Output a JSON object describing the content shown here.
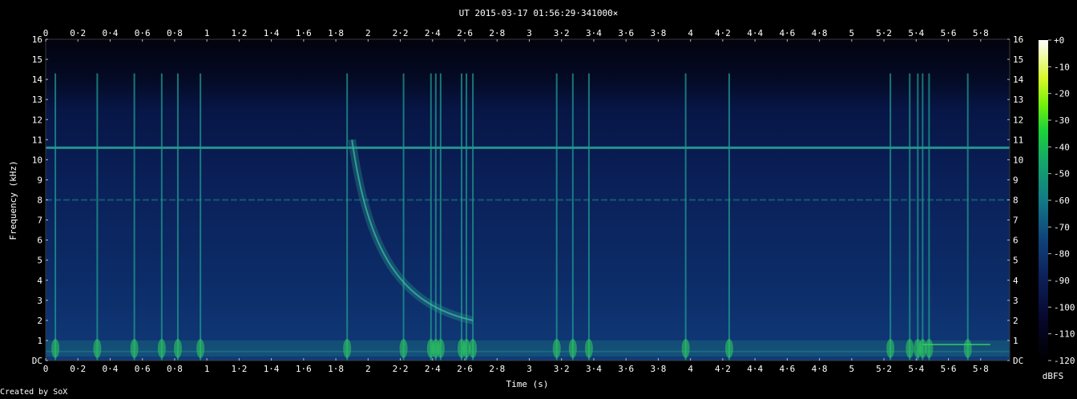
{
  "title": "UT 2015-03-17 01:56:29·341000×",
  "credit": "Created by SoX",
  "chart_data": {
    "type": "heatmap",
    "title": "UT 2015-03-17 01:56:29·341000×",
    "xlabel": "Time (s)",
    "ylabel": "Frequency (kHz)",
    "xlim": [
      0,
      5.98
    ],
    "ylim": [
      0,
      16
    ],
    "x_ticks": [
      "0",
      "0·2",
      "0·4",
      "0·6",
      "0·8",
      "1",
      "1·2",
      "1·4",
      "1·6",
      "1·8",
      "2",
      "2·2",
      "2·4",
      "2·6",
      "2·8",
      "3",
      "3·2",
      "3·4",
      "3·6",
      "3·8",
      "4",
      "4·2",
      "4·4",
      "4·6",
      "4·8",
      "5",
      "5·2",
      "5·4",
      "5·6",
      "5·8"
    ],
    "y_ticks": [
      "DC",
      "1",
      "2",
      "3",
      "4",
      "5",
      "6",
      "7",
      "8",
      "9",
      "10",
      "11",
      "12",
      "13",
      "14",
      "15",
      "16"
    ],
    "colorbar": {
      "label": "dBFS",
      "range": [
        -120,
        0
      ],
      "ticks": [
        "+0",
        "-10",
        "-20",
        "-30",
        "-40",
        "-50",
        "-60",
        "-70",
        "-80",
        "-90",
        "-100",
        "-110",
        "-120"
      ]
    },
    "features": {
      "hum_lines_khz": [
        10.6,
        8.0,
        0.45
      ],
      "impulses_s": [
        0.06,
        0.32,
        0.55,
        0.72,
        0.82,
        0.96,
        1.87,
        2.22,
        2.39,
        2.42,
        2.45,
        2.58,
        2.61,
        2.65,
        3.17,
        3.27,
        3.37,
        3.97,
        4.24,
        5.24,
        5.36,
        5.41,
        5.44,
        5.48,
        5.72
      ],
      "whistler": {
        "start_s": 1.9,
        "start_khz": 11.0,
        "end_s": 2.65,
        "end_khz": 2.0
      }
    }
  }
}
